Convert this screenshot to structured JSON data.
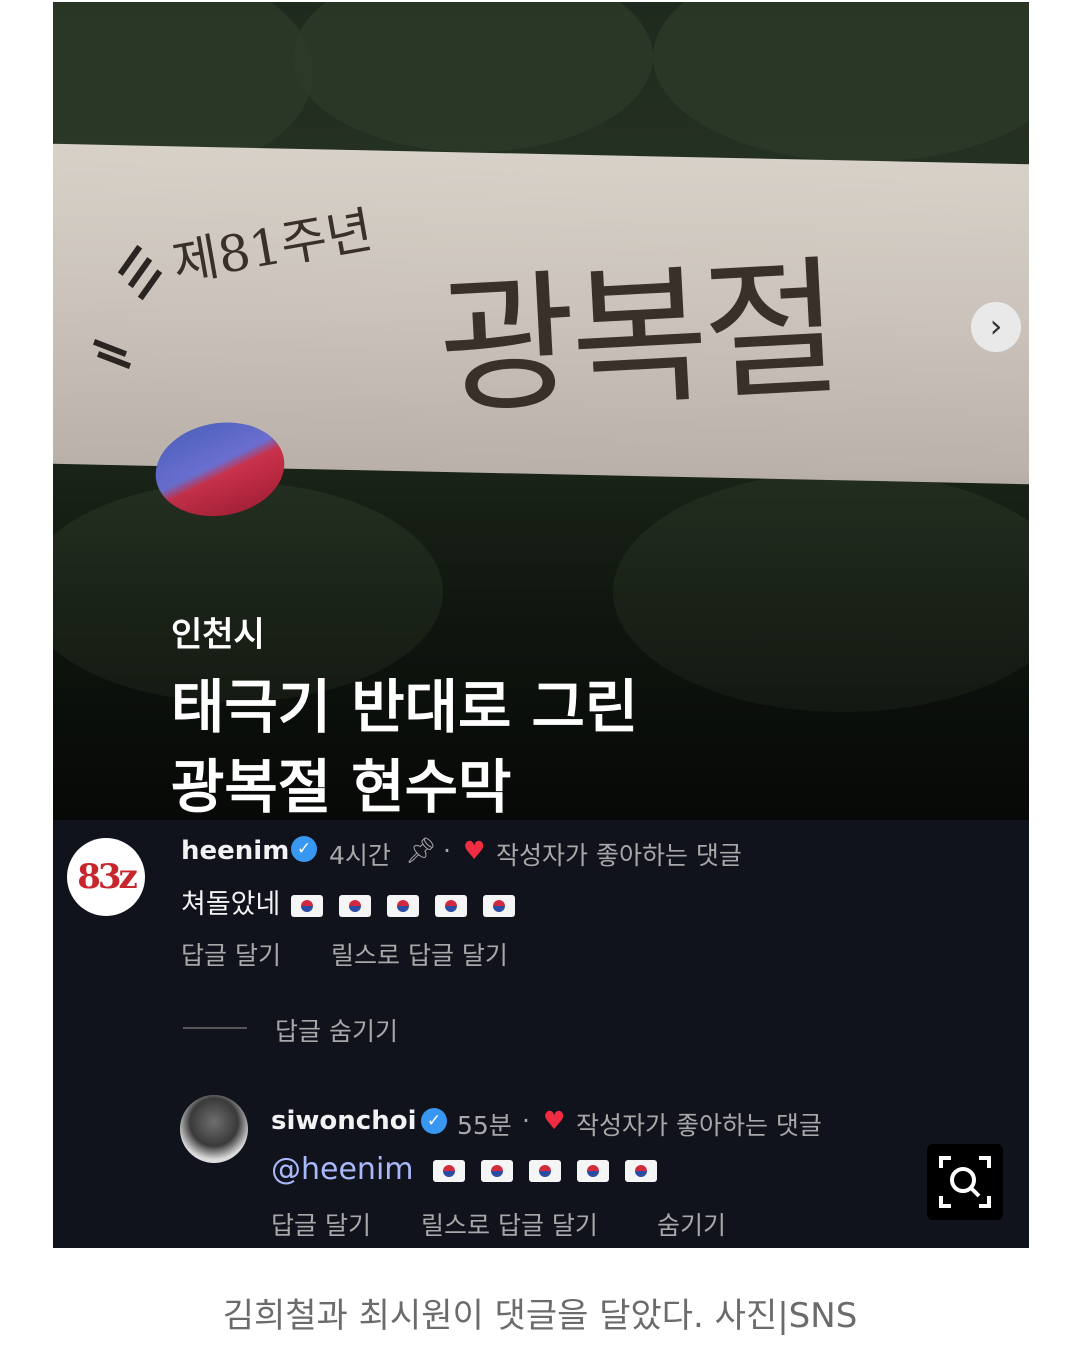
{
  "post": {
    "banner_small_text": "제81주년",
    "banner_big_text": "광복절",
    "caption_city": "인천시",
    "caption_line1": "태극기 반대로 그린",
    "caption_line2": "광복절 현수막",
    "next_icon": "chevron-right-icon"
  },
  "comments": [
    {
      "avatar_text": "83z",
      "username": "heenim",
      "time": "4시간",
      "liked_label": "작성자가 좋아하는 댓글",
      "text": "쳐돌았네",
      "flag_count": 5,
      "actions": [
        "답글 달기",
        "릴스로 답글 달기"
      ],
      "hide_replies": "답글 숨기기"
    },
    {
      "username": "siwonchoi",
      "time": "55분",
      "liked_label": "작성자가 좋아하는 댓글",
      "mention": "@heenim",
      "flag_count": 5,
      "actions": [
        "답글 달기",
        "릴스로 답글 달기",
        "숨기기"
      ]
    }
  ],
  "icons": {
    "verified": "verified-badge-icon",
    "pin": "pin-icon",
    "heart": "heart-icon",
    "flag": "south-korea-flag-icon",
    "lens": "visual-search-icon"
  },
  "colors": {
    "verified": "#3897f0",
    "heart": "#ef2c41",
    "mention": "#a8b8f8",
    "background": "#10121c"
  },
  "footer": {
    "caption": "김희철과 최시원이 댓글을 달았다. 사진|SNS"
  }
}
